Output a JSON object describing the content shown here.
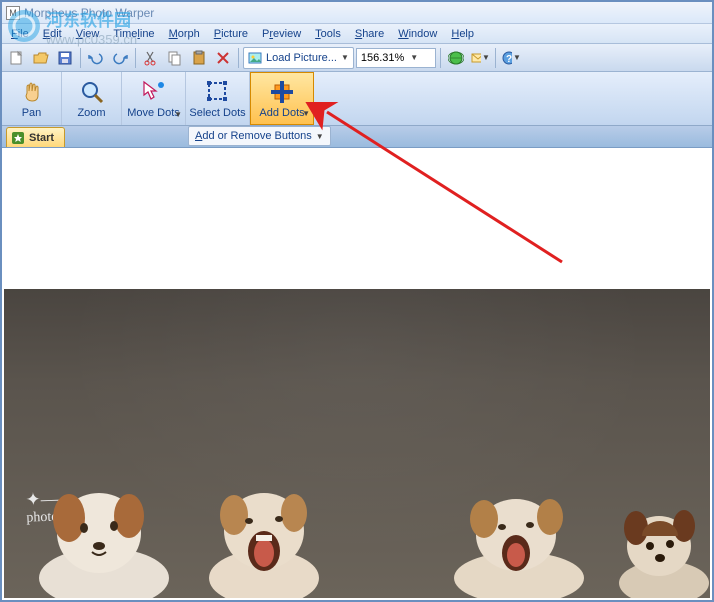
{
  "window": {
    "title": "Morpheus Photo Warper"
  },
  "menu": {
    "file": "File",
    "edit": "Edit",
    "view": "View",
    "timeline": "Timeline",
    "morph": "Morph",
    "picture": "Picture",
    "preview": "Preview",
    "tools": "Tools",
    "share": "Share",
    "windowm": "Window",
    "help": "Help"
  },
  "toolbar": {
    "load_picture": "Load Picture...",
    "zoom_level": "156.31%"
  },
  "tools": {
    "pan": "Pan",
    "zoom": "Zoom",
    "move_dots": "Move Dots",
    "select_dots": "Select Dots",
    "add_dots": "Add Dots"
  },
  "tabs": {
    "start": "Start"
  },
  "dropdowns": {
    "add_remove": "Add or Remove Buttons"
  },
  "watermark": {
    "line1": "河东软件园",
    "url": "www.pc0359.cn"
  },
  "signature": "photo"
}
